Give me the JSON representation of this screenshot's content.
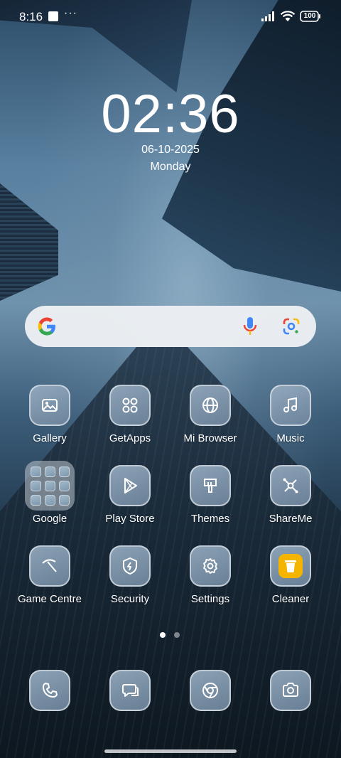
{
  "status_bar": {
    "time": "8:16",
    "more": "···",
    "battery": "100"
  },
  "clock": {
    "time": "02:36",
    "date": "06-10-2025",
    "day": "Monday"
  },
  "search": {
    "logo": "google-g-icon",
    "voice_icon": "mic-icon",
    "lens_icon": "google-lens-icon"
  },
  "apps": [
    {
      "label": "Gallery",
      "icon": "gallery-icon"
    },
    {
      "label": "GetApps",
      "icon": "grid-icon"
    },
    {
      "label": "Mi Browser",
      "icon": "globe-icon"
    },
    {
      "label": "Music",
      "icon": "music-note-icon"
    },
    {
      "label": "Google",
      "icon": "folder-icon"
    },
    {
      "label": "Play Store",
      "icon": "play-store-icon"
    },
    {
      "label": "Themes",
      "icon": "paint-brush-icon"
    },
    {
      "label": "ShareMe",
      "icon": "share-nodes-icon"
    },
    {
      "label": "Game Centre",
      "icon": "game-centre-icon"
    },
    {
      "label": "Security",
      "icon": "shield-bolt-icon"
    },
    {
      "label": "Settings",
      "icon": "gear-icon"
    },
    {
      "label": "Cleaner",
      "icon": "trash-icon"
    }
  ],
  "dock": [
    {
      "icon": "phone-icon"
    },
    {
      "icon": "messages-icon"
    },
    {
      "icon": "chrome-icon"
    },
    {
      "icon": "camera-icon"
    }
  ],
  "pager": {
    "pages": 2,
    "current": 1
  },
  "colors": {
    "icon_tile": "#8aa3ba",
    "cleaner_accent": "#f4b400",
    "search_bg": "#eceff3"
  }
}
